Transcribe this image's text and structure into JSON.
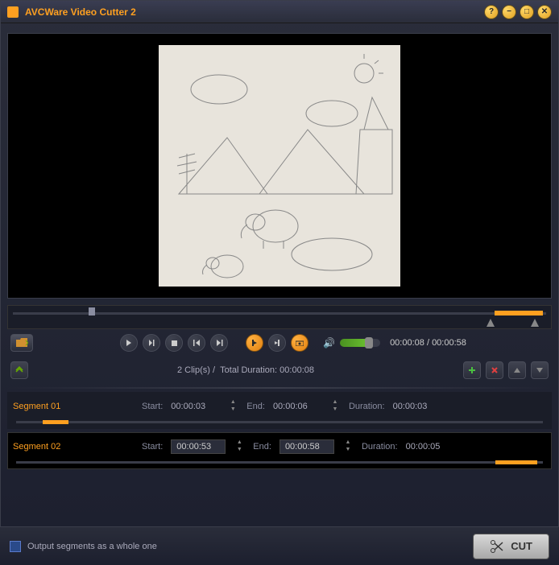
{
  "window": {
    "title": "AVCWare Video Cutter 2"
  },
  "playback": {
    "current_time": "00:00:08",
    "total_time": "00:00:58"
  },
  "clips_summary": {
    "count": "2 Clip(s)",
    "total_label": "Total Duration:",
    "total_duration": "00:00:08"
  },
  "segments": [
    {
      "name": "Segment 01",
      "start_label": "Start:",
      "start": "00:00:03",
      "end_label": "End:",
      "end": "00:00:06",
      "dur_label": "Duration:",
      "duration": "00:00:03"
    },
    {
      "name": "Segment 02",
      "start_label": "Start:",
      "start": "00:00:53",
      "end_label": "End:",
      "end": "00:00:58",
      "dur_label": "Duration:",
      "duration": "00:00:05"
    }
  ],
  "footer": {
    "checkbox_label": "Output segments as a whole one",
    "cut_label": "CUT"
  }
}
